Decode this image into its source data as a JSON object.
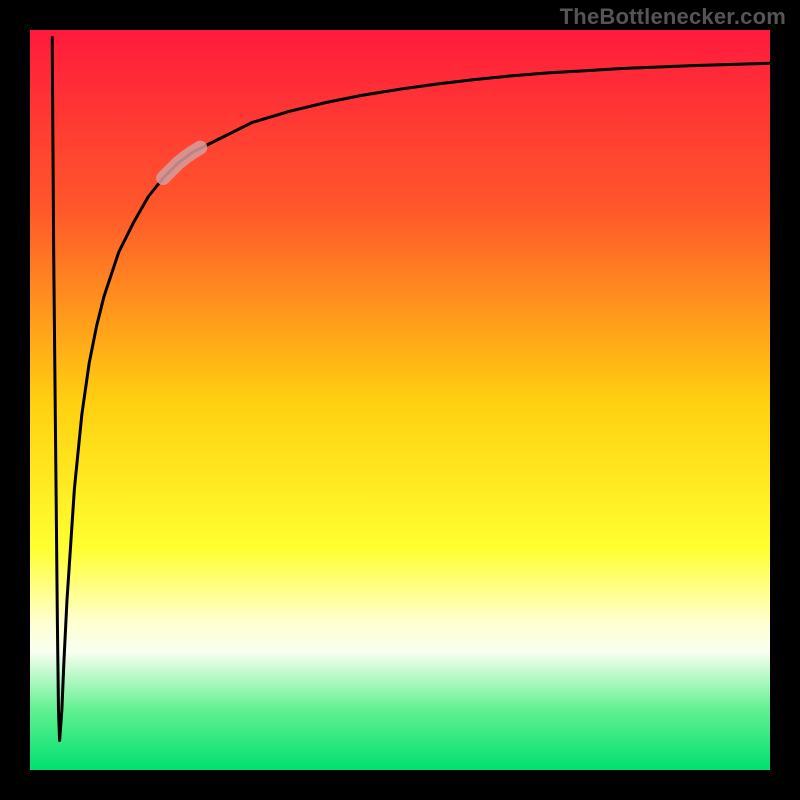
{
  "attribution": "TheBottlenecker.com",
  "chart_data": {
    "type": "line",
    "title": "",
    "xlabel": "",
    "ylabel": "",
    "xlim": [
      0,
      100
    ],
    "ylim": [
      0,
      100
    ],
    "background_gradient": {
      "orientation": "vertical",
      "stops": [
        {
          "pos": 0.0,
          "color": "#ff1a3c"
        },
        {
          "pos": 0.25,
          "color": "#ff5a2a"
        },
        {
          "pos": 0.5,
          "color": "#ffcf10"
        },
        {
          "pos": 0.7,
          "color": "#ffff30"
        },
        {
          "pos": 0.8,
          "color": "#ffffd0"
        },
        {
          "pos": 0.84,
          "color": "#f8fff0"
        },
        {
          "pos": 0.92,
          "color": "#60f090"
        },
        {
          "pos": 1.0,
          "color": "#00e070"
        }
      ]
    },
    "series": [
      {
        "name": "bottleneck-curve",
        "color": "#000000",
        "x": [
          3.0,
          3.2,
          3.5,
          3.7,
          3.85,
          4.0,
          4.3,
          4.6,
          5.0,
          6.0,
          7.0,
          8.0,
          9.0,
          10.0,
          12.0,
          14.0,
          16.0,
          18.0,
          20.0,
          22.0,
          25.0,
          30.0,
          35.0,
          40.0,
          45.0,
          50.0,
          55.0,
          60.0,
          65.0,
          70.0,
          75.0,
          80.0,
          85.0,
          90.0,
          95.0,
          100.0
        ],
        "y": [
          99.0,
          70.0,
          40.0,
          20.0,
          8.0,
          4.0,
          8.0,
          15.0,
          23.0,
          38.0,
          48.0,
          55.0,
          60.0,
          64.0,
          70.0,
          74.0,
          77.5,
          80.0,
          82.0,
          83.5,
          85.0,
          87.5,
          89.0,
          90.2,
          91.2,
          92.0,
          92.7,
          93.3,
          93.8,
          94.2,
          94.5,
          94.8,
          95.0,
          95.2,
          95.35,
          95.5
        ]
      }
    ],
    "highlight": {
      "name": "bottleneck-marker",
      "color": "#d69e9e",
      "x": [
        18.0,
        19.0,
        20.0,
        21.0,
        22.0,
        23.0
      ],
      "y": [
        80.0,
        81.0,
        82.0,
        82.8,
        83.5,
        84.1
      ]
    }
  }
}
